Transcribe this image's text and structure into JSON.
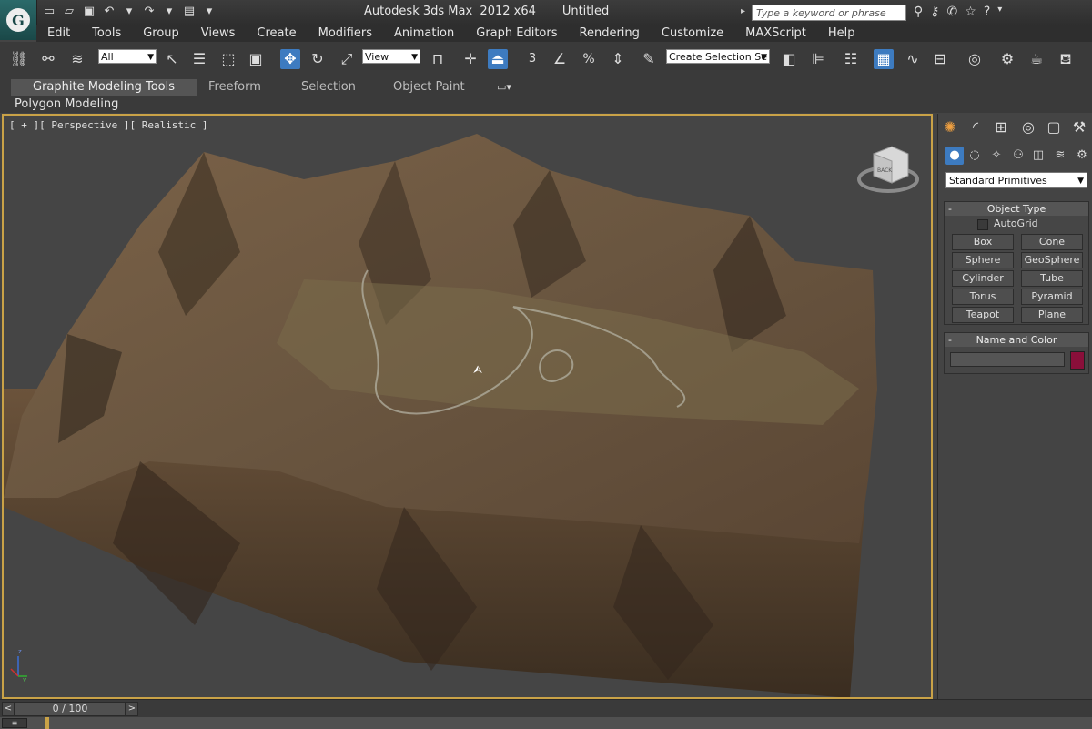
{
  "title_bar": {
    "title": "Autodesk 3ds Max  2012 x64       Untitled",
    "logo_letter": "G",
    "search_placeholder": "Type a keyword or phrase",
    "help_label": "?"
  },
  "menu": [
    "Edit",
    "Tools",
    "Group",
    "Views",
    "Create",
    "Modifiers",
    "Animation",
    "Graph Editors",
    "Rendering",
    "Customize",
    "MAXScript",
    "Help"
  ],
  "toolbar": {
    "selection_filter": "All",
    "reference_coord": "View",
    "named_selection": "Create Selection Se",
    "snap_label": "3",
    "percent_label": "%"
  },
  "ribbon": {
    "tabs": [
      "Graphite Modeling Tools",
      "Freeform",
      "Selection",
      "Object Paint"
    ],
    "active_tab": "Graphite Modeling Tools",
    "panel_label": "Polygon Modeling"
  },
  "viewport": {
    "label": "[ + ][ Perspective ][ Realistic ]",
    "viewcube_face": "BACK"
  },
  "command_panel": {
    "category": "Standard Primitives",
    "object_type_title": "Object Type",
    "autogrid_label": "AutoGrid",
    "primitives": [
      "Box",
      "Cone",
      "Sphere",
      "GeoSphere",
      "Cylinder",
      "Tube",
      "Torus",
      "Pyramid",
      "Teapot",
      "Plane"
    ],
    "name_color_title": "Name and Color",
    "name_value": "",
    "object_color": "#8a0f3a"
  },
  "timeline": {
    "frame_display": "0 / 100",
    "prev_label": "<",
    "next_label": ">"
  },
  "colors": {
    "active_viewport_border": "#c9a247",
    "active_tool": "#3d7bc0"
  }
}
